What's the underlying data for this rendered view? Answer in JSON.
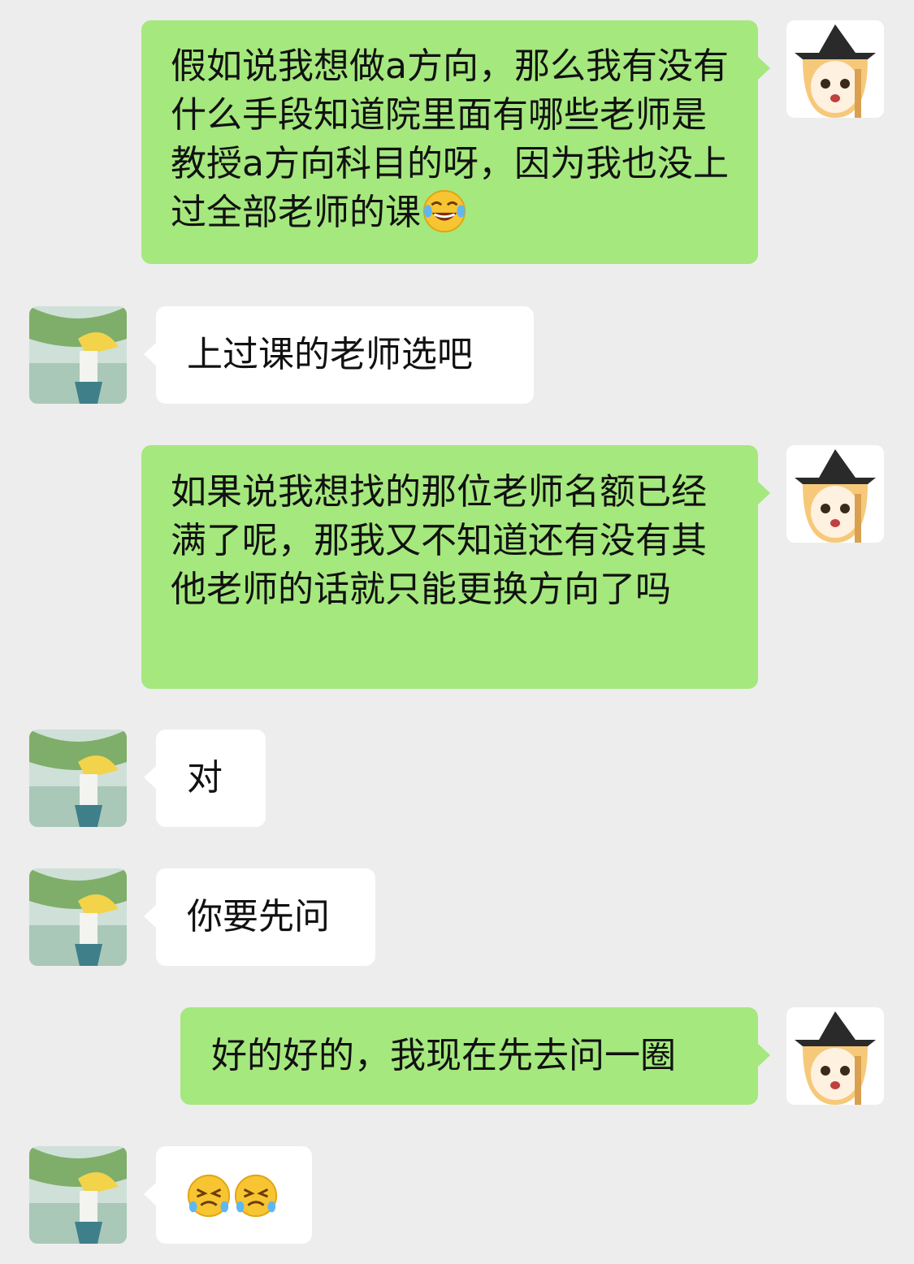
{
  "messages": [
    {
      "from": "me",
      "text": "假如说我想做a方向，那么我有没有什么手段知道院里面有哪些老师是教授a方向科目的呀，因为我也没上过全部老师的课",
      "emoji_after": "joy-icon"
    },
    {
      "from": "other",
      "text": "上过课的老师选吧"
    },
    {
      "from": "me",
      "text": "如果说我想找的那位老师名额已经满了呢，那我又不知道还有没有其他老师的话就只能更换方向了吗"
    },
    {
      "from": "other",
      "text": "对"
    },
    {
      "from": "other",
      "text": "你要先问"
    },
    {
      "from": "me",
      "text": "好的好的，我现在先去问一圈"
    },
    {
      "from": "other",
      "text": "",
      "emojis": [
        "persevering-face-icon",
        "persevering-face-icon"
      ]
    }
  ],
  "colors": {
    "background": "#ededed",
    "my_bubble": "#a5e87e",
    "their_bubble": "#ffffff"
  }
}
